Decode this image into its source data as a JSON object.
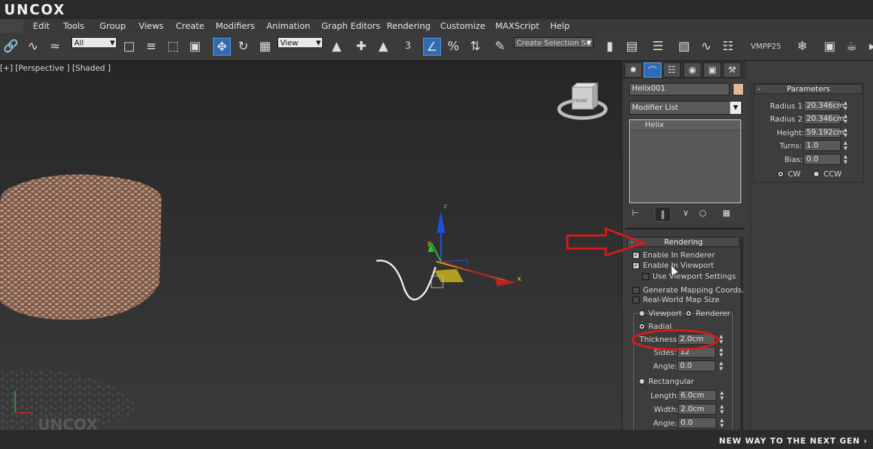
{
  "app": {
    "logo_text": "UNCOX"
  },
  "menu": [
    "Edit",
    "Tools",
    "Group",
    "Views",
    "Create",
    "Modifiers",
    "Animation",
    "Graph Editors",
    "Rendering",
    "Customize",
    "MAXScript",
    "Help"
  ],
  "toolbar": {
    "filter_value": "All",
    "refcoord_value": "View",
    "snap_value": "3",
    "selection_set_placeholder": "Create Selection Se",
    "renderer_label": "VMPP25"
  },
  "viewport": {
    "label": "[+] [Perspective ] [Shaded ]",
    "viewcube_face": "FRONT",
    "axis_x": "x",
    "axis_y": "y",
    "axis_z": "z"
  },
  "command_panel": {
    "object_name": "Helix001",
    "object_color": "#e0b89c",
    "modifier_list_label": "Modifier List",
    "stack_items": [
      "Helix"
    ]
  },
  "parameters": {
    "title": "Parameters",
    "radius1_label": "Radius 1:",
    "radius1": "20.346cm",
    "radius2_label": "Radius 2:",
    "radius2": "20.346cm",
    "height_label": "Height:",
    "height": "59.192cm",
    "turns_label": "Turns:",
    "turns": "1.0",
    "bias_label": "Bias:",
    "bias": "0.0",
    "cw": "CW",
    "ccw": "CCW"
  },
  "rendering": {
    "title": "Rendering",
    "enable_in_renderer": "Enable In Renderer",
    "enable_in_viewport": "Enable In Viewport",
    "use_viewport_settings": "Use Viewport Settings",
    "gen_mapping": "Generate Mapping Coords.",
    "real_world": "Real-World Map Size",
    "viewport_opt": "Viewport",
    "renderer_opt": "Renderer",
    "radial": "Radial",
    "thickness_label": "Thickness:",
    "thickness": "2.0cm",
    "sides_label": "Sides:",
    "sides": "12",
    "angle_label": "Angle:",
    "angle": "0.0",
    "rectangular": "Rectangular",
    "length_label": "Length:",
    "length": "6.0cm",
    "width_label": "Width:",
    "width": "2.0cm",
    "angle2_label": "Angle:",
    "angle2": "0.0"
  },
  "footer": {
    "slogan": "NEW WAY TO THE NEXT GEN ›"
  },
  "colors": {
    "accent": "#2f6bb3",
    "annotation": "#e01818"
  }
}
